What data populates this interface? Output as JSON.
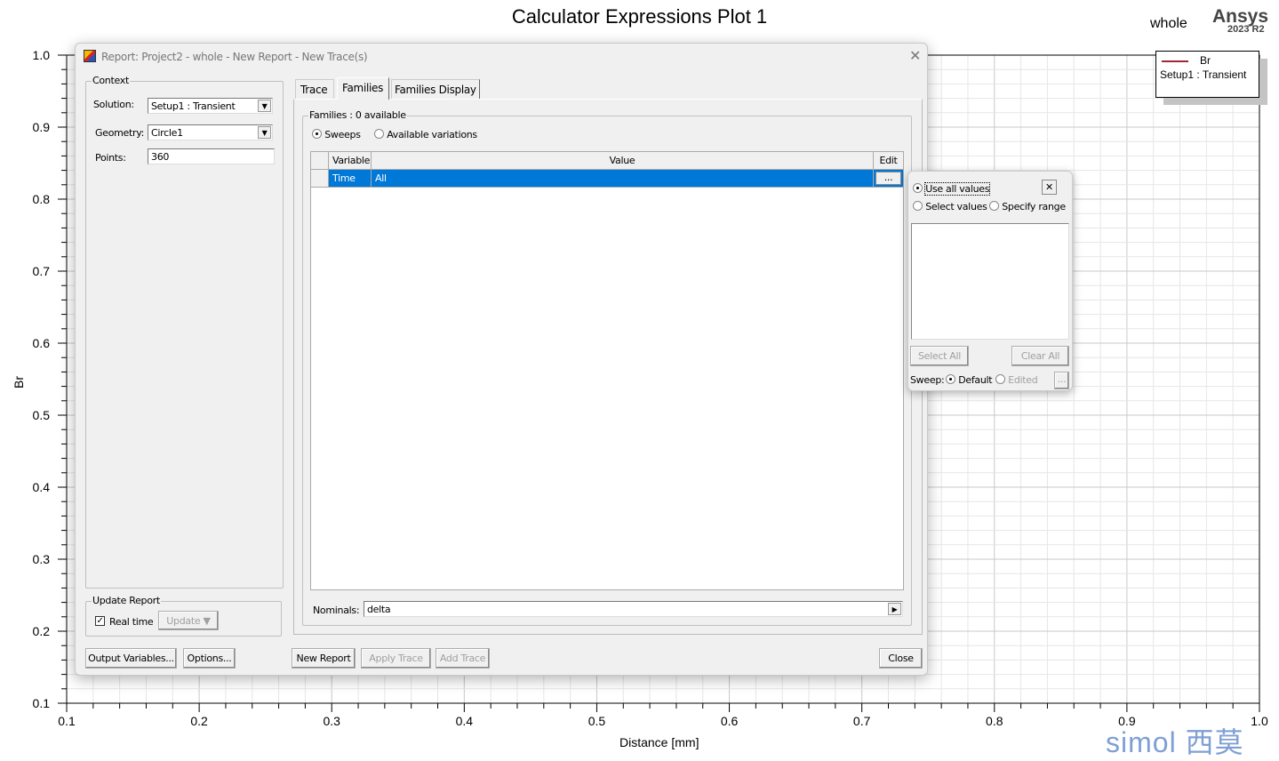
{
  "chart_data": {
    "type": "line",
    "title": "Calculator Expressions Plot 1",
    "subtitle": "whole",
    "xlabel": "Distance [mm]",
    "ylabel": "Br",
    "xlim": [
      0.1,
      1.0
    ],
    "ylim": [
      0.1,
      1.0
    ],
    "x_ticks": [
      "0.1",
      "0.2",
      "0.3",
      "0.4",
      "0.5",
      "0.6",
      "0.7",
      "0.8",
      "0.9",
      "1.0"
    ],
    "y_ticks": [
      "0.1",
      "0.2",
      "0.3",
      "0.4",
      "0.5",
      "0.6",
      "0.7",
      "0.8",
      "0.9",
      "1.0"
    ],
    "grid": true,
    "legend_position": "top-right",
    "series": [
      {
        "name": "Br",
        "legend_sub": "Setup1 : Transient",
        "color": "#a0283c",
        "x": [],
        "y": []
      }
    ]
  },
  "branding": {
    "product": "Ansys",
    "version": "2023 R2",
    "watermark": "simol 西莫"
  },
  "dialog": {
    "title": "Report: Project2 - whole - New Report - New Trace(s)",
    "context": {
      "label": "Context",
      "solution_label": "Solution:",
      "solution_value": "Setup1 : Transient",
      "geometry_label": "Geometry:",
      "geometry_value": "Circle1",
      "points_label": "Points:",
      "points_value": "360"
    },
    "update_report": {
      "label": "Update Report",
      "realtime_label": "Real time",
      "realtime_checked": true,
      "update_button": "Update"
    },
    "buttons": {
      "output_variables": "Output Variables...",
      "options": "Options...",
      "new_report": "New Report",
      "apply_trace": "Apply Trace",
      "add_trace": "Add Trace",
      "close": "Close"
    },
    "tabs": [
      {
        "label": "Trace"
      },
      {
        "label": "Families",
        "active": true
      },
      {
        "label": "Families Display"
      }
    ],
    "families": {
      "label": "Families : 0 available",
      "sweeps_label": "Sweeps",
      "available_variations_label": "Available variations",
      "columns": [
        "Variable",
        "Value",
        "Edit"
      ],
      "rows": [
        {
          "variable": "Time",
          "value": "All",
          "edit": "..."
        }
      ],
      "nominals_label": "Nominals:",
      "nominals_value": "delta"
    },
    "popup": {
      "use_all": "Use all values",
      "select_values": "Select values",
      "specify_range": "Specify range",
      "select_all": "Select All",
      "clear_all": "Clear All",
      "sweep_label": "Sweep:",
      "default_label": "Default",
      "edited_label": "Edited",
      "more": "...",
      "close": "✕"
    }
  }
}
